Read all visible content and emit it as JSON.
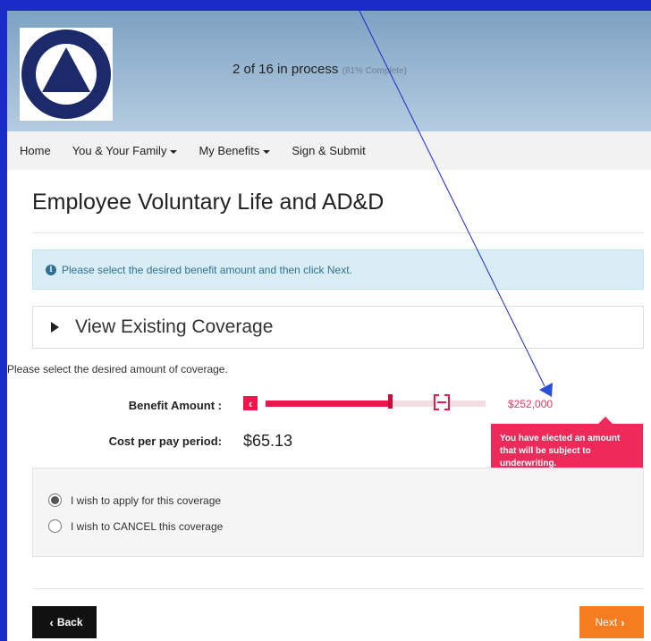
{
  "header": {
    "logo_name": "Pottstown School District seal",
    "progress_main": "2 of 16 in process",
    "progress_sub": "(81% Complete)"
  },
  "nav": {
    "home": "Home",
    "family": "You & Your Family",
    "benefits": "My Benefits",
    "sign": "Sign & Submit"
  },
  "page": {
    "title": "Employee Voluntary Life and AD&D"
  },
  "info": {
    "message": "Please select the desired benefit amount and then click Next."
  },
  "panel": {
    "label": "View Existing Coverage"
  },
  "form": {
    "prompt": "Please select the desired amount of coverage.",
    "benefit_label": "Benefit Amount :",
    "benefit_value": "$252,000",
    "slider_fraction": 0.56,
    "cost_label": "Cost per pay period:",
    "cost_value": "$65.13",
    "tooltip": "You have elected an amount that will be subject to underwriting."
  },
  "options": {
    "apply": "I wish to apply for this coverage",
    "cancel": "I wish to CANCEL this coverage",
    "selected": "apply"
  },
  "footer": {
    "back": "Back",
    "next": "Next"
  },
  "colors": {
    "accent": "#f0154d",
    "next_button": "#f57c1f",
    "info_bg": "#d9edf7",
    "annotation": "#1a2bc8"
  }
}
